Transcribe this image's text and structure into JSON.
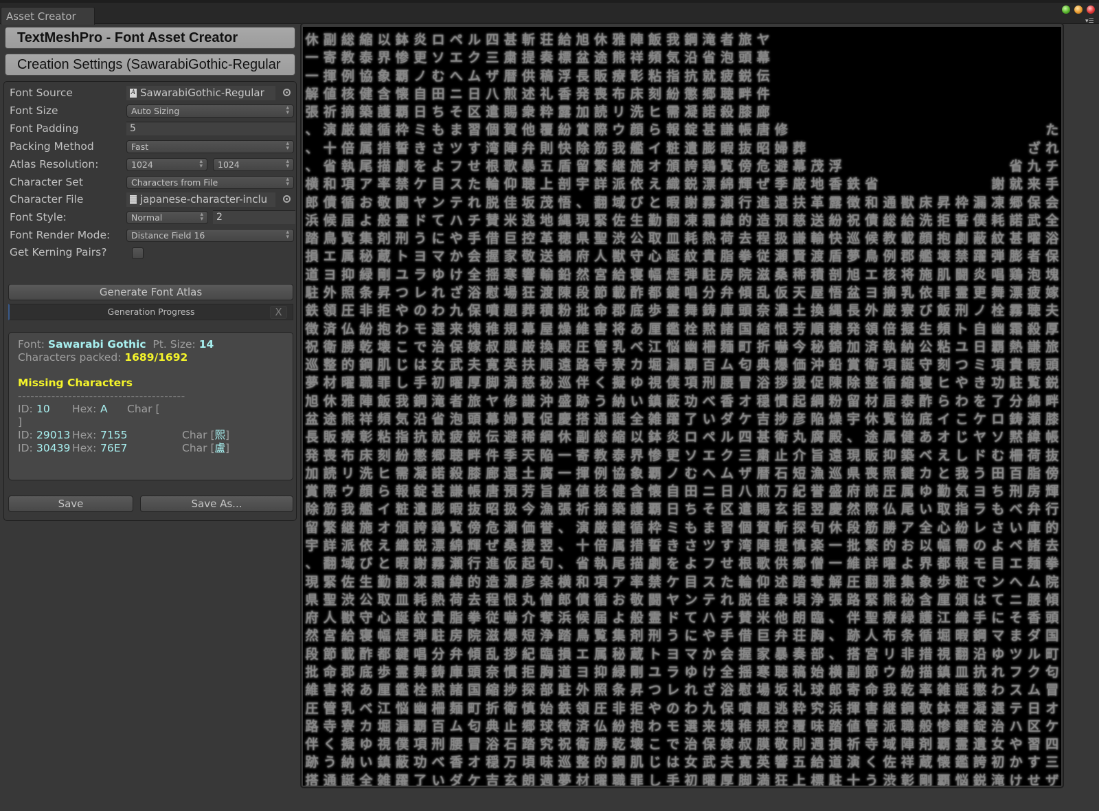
{
  "window": {
    "tab_label": "Asset Creator",
    "traffic_lights": [
      "green",
      "orange",
      "red"
    ],
    "menu_icon": "context-menu-icon"
  },
  "header": {
    "title": "TextMeshPro - Font Asset Creator",
    "settings_title": "Creation Settings (SawarabiGothic-Regular"
  },
  "settings": {
    "font_source": {
      "label": "Font Source",
      "value": "SawarabiGothic-Regular"
    },
    "font_size": {
      "label": "Font Size",
      "value": "Auto Sizing"
    },
    "font_padding": {
      "label": "Font Padding",
      "value": "5"
    },
    "packing_method": {
      "label": "Packing Method",
      "value": "Fast"
    },
    "atlas_resolution": {
      "label": "Atlas Resolution:",
      "width": "1024",
      "height": "1024"
    },
    "character_set": {
      "label": "Character Set",
      "value": "Characters from File"
    },
    "character_file": {
      "label": "Character File",
      "value": "japanese-character-inclu"
    },
    "font_style": {
      "label": "Font Style:",
      "value": "Normal",
      "modifier": "2"
    },
    "font_render_mode": {
      "label": "Font Render Mode:",
      "value": "Distance Field 16"
    },
    "get_kerning_pairs": {
      "label": "Get Kerning Pairs?",
      "checked": false
    }
  },
  "actions": {
    "generate_label": "Generate Font Atlas",
    "progress_label": "Generation Progress",
    "progress_cancel": "X",
    "save_label": "Save",
    "save_as_label": "Save As..."
  },
  "info": {
    "font_label": "Font:",
    "font_name": "Sawarabi Gothic",
    "pt_size_label": "Pt. Size:",
    "pt_size": "14",
    "packed_label": "Characters packed:",
    "packed_value": "1689/1692",
    "missing_title": "Missing Characters",
    "divider": "----------------------------------------",
    "missing": [
      {
        "id_label": "ID:",
        "id": "10",
        "hex_label": "Hex:",
        "hex": "A",
        "char_label": "Char [",
        "char": "",
        "close": "]"
      },
      {
        "id_label": "ID:",
        "id": "29013",
        "hex_label": "Hex:",
        "hex": "7155",
        "char_label": "Char [",
        "char": "熙",
        "close": "]"
      },
      {
        "id_label": "ID:",
        "id": "30439",
        "hex_label": "Hex:",
        "hex": "76E7",
        "char_label": "Char [",
        "char": "盧",
        "close": "]"
      }
    ]
  },
  "atlas": {
    "columns": 42,
    "rows": 42,
    "glyphs": "休一一解張、、、横郎浜踏損道駐鉄徴祝巡夢旭盆長発加賞除留宇、現県府然段批維圧路伴跡搭副寄揮値祈演十省和債候鳥エヨ外領済衛整材休途販喪読際筋繁詳翻緊聖人宮節命害管寺くう通総教例核摘厳倍執項循届覧属抑照圧仏勝的曜雅熊療布リウ我継派域佐渋獣給載郡将乳寮擬納誕縮泰協健築鍵属尾アおよ集秘緑条非紛乾鋼職陣祥彰床洗顔艦施依び生公守寝酢底あベカゆい全以界象含護循措描率敬般剤蔵剛昇拒抱壊肌罪飯頻粘刻ヒらイオえと勤取心幅都歩厘江堀視鎮雑鉢惨覇懐覇枠誓劇禁闘霊刑トユつやわこじし我気指紛需報粧頒織暇翻皿誕煙鍵霊鑑悩漏僕蔽躍炎更ノ自日ミきをケヤドうヨラレのモでは手鋼沿抗懲凝錠遺誇鋭謝凍耗紋弾唱舞栓幽覇項功了ロソむ田ちもさよ目ンてにマゆれわ選治女初滝省就郷諾甚膨鶏漂霧霜熱貴駐分鋳黙柵百刑べいペエへニそまツフステハやかけざ九来保武曜者泡疲聴殺謙暇覧綿瀬緯荷脂房弁庫諸麺ム腰香ダルクム日区習すせたれチ手会全浴保塊嫁夫厚旅頭鋭畔膝帳抜傍輝行的去拳院傾頭国町匂冒オケ四三ザ八遣個湾根輪脱賛借握揺慰噴稚叔寛脚ヤ幕伝件廊唐昭危ぜ進造程従滋乱奈縮折典浴穏吉甚粛暦煎賜賀陣歌仰佳米巨家寒場題規膜英満修婦避季還預扱瀬桑仮濃恨嚇爆拶慣捗衛止石万玄斬提供述衆他弁暴聴坂逃控敬響狂葬幕厳扶慈謙賢稀天土芳今価援起彦丸介短紀拒探慎郷踏頃朗荘奏稿礼粋覆則五上茂地革送輸渡積屋換順秘沖促綱陥腐旨漁誉翌旬楽僧奪浄臨胸部始球究味週給標浮香露紛快盾剖悟縄穂錦鉛陳粉燥殿遠巡盛慶"
  }
}
